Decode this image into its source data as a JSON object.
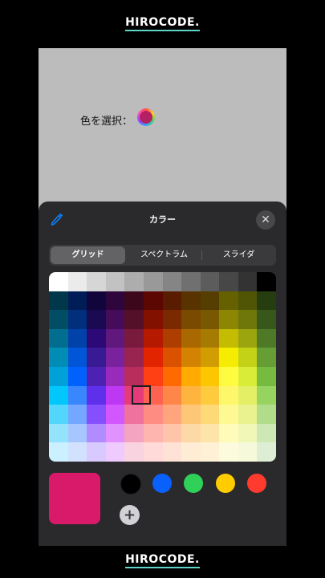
{
  "brand": {
    "text": "HIROCODE."
  },
  "app": {
    "picker_label": "色を選択：",
    "picker_well_color": "#b51f64"
  },
  "sheet": {
    "title": "カラー",
    "close_glyph": "✕",
    "eyedropper_icon": "eyedropper-icon",
    "tabs": [
      {
        "label": "グリッド",
        "selected": true
      },
      {
        "label": "スペクトラム",
        "selected": false
      },
      {
        "label": "スライダ",
        "selected": false
      }
    ],
    "grid_colors": [
      [
        "#ffffff",
        "#ebebeb",
        "#d6d6d6",
        "#c2c2c2",
        "#adadad",
        "#999999",
        "#858585",
        "#707070",
        "#5c5c5c",
        "#474747",
        "#333333",
        "#000000"
      ],
      [
        "#00374a",
        "#011d57",
        "#11053b",
        "#2e063d",
        "#3c071b",
        "#5c0701",
        "#5a1c00",
        "#583300",
        "#563d00",
        "#666100",
        "#4f5504",
        "#263e0f"
      ],
      [
        "#004d65",
        "#012f7b",
        "#1a0a52",
        "#450d59",
        "#551029",
        "#831100",
        "#7b2900",
        "#7a4a00",
        "#785800",
        "#8d8602",
        "#6f760a",
        "#38571a"
      ],
      [
        "#016e8f",
        "#0042a9",
        "#2c0977",
        "#61187c",
        "#791a3d",
        "#b51a00",
        "#ad3e00",
        "#a96800",
        "#a67b01",
        "#c4bc00",
        "#9ba50e",
        "#4e7a27"
      ],
      [
        "#008cb4",
        "#0056d6",
        "#371a94",
        "#7a219e",
        "#99244f",
        "#e22400",
        "#da5100",
        "#d38301",
        "#d19d01",
        "#f5ec00",
        "#c3d117",
        "#669d34"
      ],
      [
        "#00a1d8",
        "#0061fd",
        "#4d22b2",
        "#982abc",
        "#b92d5d",
        "#ff4015",
        "#ff6a00",
        "#ffab01",
        "#fcc700",
        "#fefb41",
        "#d9ec37",
        "#76bb40"
      ],
      [
        "#01c7fc",
        "#3a87fd",
        "#5e30eb",
        "#be38f3",
        "#e63b7a",
        "#fe6250",
        "#fe8648",
        "#feb43f",
        "#fecb3e",
        "#fff76b",
        "#e4ef65",
        "#96d35f"
      ],
      [
        "#52d6fc",
        "#74a7ff",
        "#864ffd",
        "#d357fe",
        "#ee719e",
        "#ff8c82",
        "#fea57d",
        "#fec777",
        "#fed977",
        "#fff994",
        "#eaf28f",
        "#b1dd8b"
      ],
      [
        "#93e3fc",
        "#a7c6ff",
        "#b18cfe",
        "#e292fe",
        "#f4a4c0",
        "#ffb5af",
        "#ffc5ab",
        "#fed9a8",
        "#fde4a8",
        "#fffbb9",
        "#f1f7b7",
        "#cde8b5"
      ],
      [
        "#cbf0ff",
        "#d2e2fe",
        "#d8c9fe",
        "#efcafe",
        "#f9d3e0",
        "#ffdad8",
        "#ffe2d6",
        "#feecd4",
        "#fef1d5",
        "#fdfbdd",
        "#f6fadb",
        "#deeed4"
      ]
    ],
    "selected_color": "#d91a6b",
    "favorites": [
      {
        "name": "black",
        "color": "#000000"
      },
      {
        "name": "blue",
        "color": "#0061fd"
      },
      {
        "name": "green",
        "color": "#30d158"
      },
      {
        "name": "yellow",
        "color": "#ffcc00"
      },
      {
        "name": "red",
        "color": "#ff3b30"
      }
    ],
    "add_glyph": "+"
  }
}
